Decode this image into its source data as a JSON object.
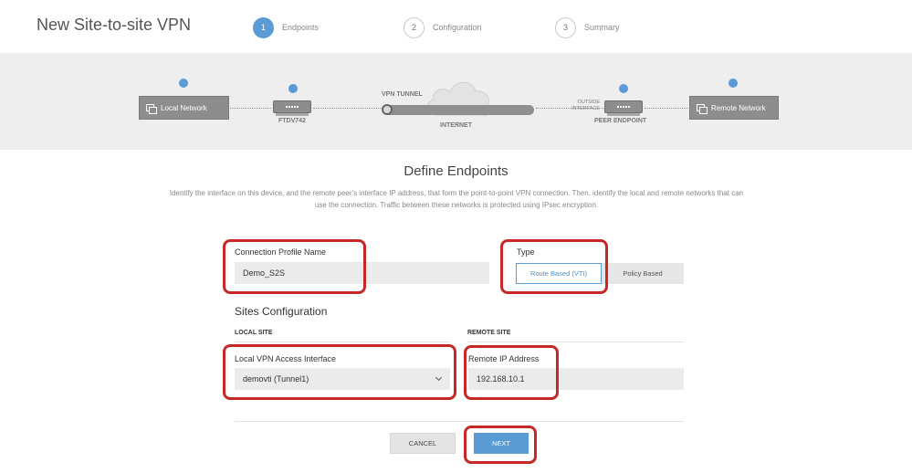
{
  "header": {
    "title": "New Site-to-site VPN",
    "steps": [
      {
        "num": "1",
        "label": "Endpoints"
      },
      {
        "num": "2",
        "label": "Configuration"
      },
      {
        "num": "3",
        "label": "Summary"
      }
    ],
    "active_step": 1
  },
  "diagram": {
    "local_network": "Local Network",
    "device_name": "FTDV742",
    "vpn_tunnel": "VPN TUNNEL",
    "internet": "INTERNET",
    "outside_interface_line1": "OUTSIDE",
    "outside_interface_line2": "INTERFACE",
    "peer_endpoint": "PEER ENDPOINT",
    "remote_network": "Remote Network"
  },
  "main": {
    "heading": "Define Endpoints",
    "description": "Identify the interface on this device, and the remote peer's interface IP address, that form the point-to-point VPN connection. Then, identify the local and remote networks that can use the connection. Traffic between these networks is protected using IPsec encryption."
  },
  "form": {
    "connection_profile_label": "Connection Profile Name",
    "connection_profile_value": "Demo_S2S",
    "type_label": "Type",
    "type_options": [
      "Route Based (VTI)",
      "Policy Based"
    ],
    "type_selected": "Route Based (VTI)",
    "sites_title": "Sites Configuration",
    "local_site_label": "LOCAL SITE",
    "remote_site_label": "REMOTE SITE",
    "local_interface_label": "Local VPN Access Interface",
    "local_interface_value": "demovti (Tunnel1)",
    "remote_ip_label": "Remote IP Address",
    "remote_ip_value": "192.168.10.1"
  },
  "buttons": {
    "cancel": "CANCEL",
    "next": "NEXT"
  },
  "colors": {
    "accent": "#5b9bd5",
    "highlight": "#c62828",
    "node": "#8d8d8d"
  }
}
